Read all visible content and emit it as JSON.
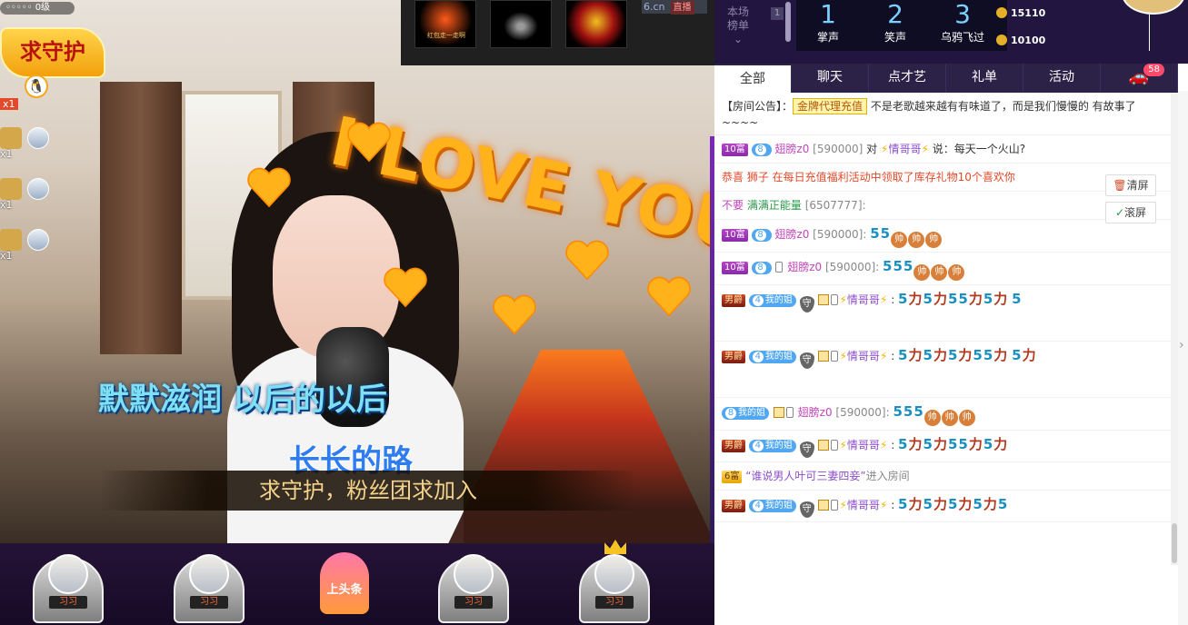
{
  "video": {
    "lyric_line1": "默默滋润  以后的以后",
    "lyric_line2": "长长的路",
    "banner_text": "求守护，粉丝团求加入",
    "effect_text": "I LOVE YOU"
  },
  "guard": {
    "level_text": "0级",
    "badge_text": "求守护",
    "count_top": "x1",
    "fans": [
      {
        "count": "x1"
      },
      {
        "count": "x1"
      },
      {
        "count": "x1"
      }
    ]
  },
  "gift_tray": {
    "items": [
      {
        "caption": "红包走一走啊"
      },
      {
        "caption": ""
      },
      {
        "caption": ""
      }
    ],
    "site": "6.cn",
    "live_tag": "直播"
  },
  "seats": {
    "items": [
      {
        "name": "习习"
      },
      {
        "name": "习习"
      },
      {
        "name": "习习"
      },
      {
        "name": "习习"
      }
    ],
    "headline_label": "上头条"
  },
  "rank": {
    "label_line1": "本场",
    "label_line2": "榜单",
    "rank_one": "1",
    "claps": [
      {
        "num": "1",
        "label": "掌声"
      },
      {
        "num": "2",
        "label": "笑声"
      },
      {
        "num": "3",
        "label": "乌鸦飞过"
      }
    ],
    "scores": [
      "15110",
      "10100"
    ]
  },
  "tabs": [
    {
      "label": "全部"
    },
    {
      "label": "聊天"
    },
    {
      "label": "点才艺"
    },
    {
      "label": "礼单"
    },
    {
      "label": "活动"
    }
  ],
  "car_badge": "58",
  "chat": {
    "notice_prefix": "【房间公告】：",
    "notice_tag": "金牌代理充值",
    "notice_text": "不是老歌越来越有有味道了，而是我们慢慢的 有故事了~~~~",
    "clear_label": "清屏",
    "scroll_label": "滚屏",
    "messages": [
      {
        "lvl": "10富",
        "fan": "8",
        "user": "翅膀z0",
        "pts": "[590000]",
        "text_to": "对",
        "target": "情哥哥",
        "text": "说：每天一个火山?"
      },
      {
        "system": "恭喜  狮子 在每日充值福利活动中领取了库存礼物10个喜欢你"
      },
      {
        "user2": "满满正能量",
        "pts2": "[6507777]:",
        "text_no": "不要"
      },
      {
        "lvl": "10富",
        "fan": "8",
        "user": "翅膀z0",
        "pts": "[590000]:"
      },
      {
        "lvl": "10富",
        "fan": "8",
        "user": "翅膀z0",
        "pts": "[590000]:"
      },
      {
        "lvl": "男爵",
        "fan": "4",
        "fan_label": "我的姐",
        "user": "情哥哥",
        "shield": "守"
      },
      {
        "lvl": "男爵",
        "fan": "4",
        "fan_label": "我的姐",
        "user": "情哥哥",
        "shield": "守"
      },
      {
        "fan": "8",
        "fan_label": "我的姐",
        "user": "翅膀z0",
        "pts": "[590000]:"
      },
      {
        "lvl": "男爵",
        "fan": "4",
        "fan_label": "我的姐",
        "user": "情哥哥",
        "shield": "守"
      },
      {
        "lvl": "6富",
        "entry_name": "“谁说男人叶可三妻四妾”",
        "entry_text": "进入房间"
      },
      {
        "lvl": "男爵",
        "fan": "4",
        "fan_label": "我的姐",
        "user": "情哥哥",
        "shield": "守"
      }
    ]
  },
  "colors": {
    "panel_dark": "#221640",
    "tab_bar": "#2c2248",
    "accent_pink": "#c246b8",
    "accent_blue": "#51a7f0"
  }
}
